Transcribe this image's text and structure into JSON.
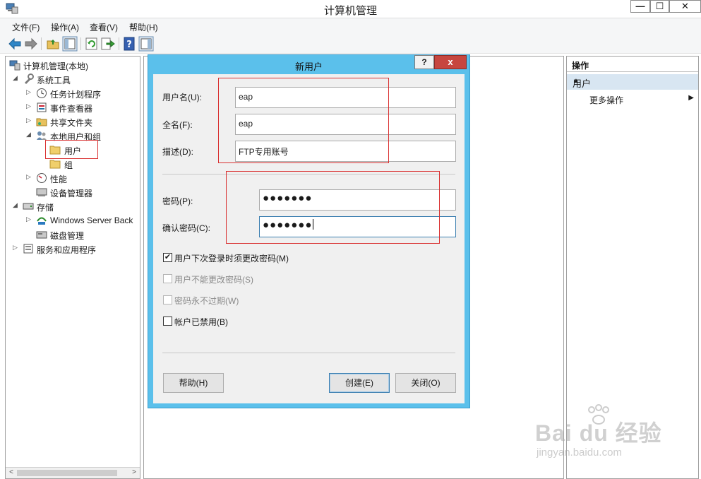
{
  "window": {
    "title": "计算机管理",
    "min_glyph": "—",
    "max_glyph": "☐",
    "close_glyph": "✕"
  },
  "menu": [
    "文件(F)",
    "操作(A)",
    "查看(V)",
    "帮助(H)"
  ],
  "tree": {
    "root": "计算机管理(本地)",
    "system_tools": "系统工具",
    "task_scheduler": "任务计划程序",
    "event_viewer": "事件查看器",
    "shared_folders": "共享文件夹",
    "local_users_groups": "本地用户和组",
    "users": "用户",
    "groups": "组",
    "performance": "性能",
    "device_manager": "设备管理器",
    "storage": "存储",
    "windows_backup": "Windows Server Back",
    "disk_management": "磁盘管理",
    "services_apps": "服务和应用程序"
  },
  "actions": {
    "header": "操作",
    "section": "用户",
    "more": "更多操作"
  },
  "dialog": {
    "title": "新用户",
    "help_glyph": "?",
    "close_glyph": "x",
    "username_label": "用户名(U):",
    "username_value": "eap",
    "fullname_label": "全名(F):",
    "fullname_value": "eap",
    "description_label": "描述(D):",
    "description_value": "FTP专用账号",
    "password_label": "密码(P):",
    "password_value": "●●●●●●●",
    "confirm_label": "确认密码(C):",
    "confirm_value": "●●●●●●●",
    "must_change_label": "用户下次登录时须更改密码(M)",
    "must_change_checked": true,
    "cannot_change_label": "用户不能更改密码(S)",
    "never_expires_label": "密码永不过期(W)",
    "disabled_label": "帐户已禁用(B)",
    "help_button": "帮助(H)",
    "create_button": "创建(E)",
    "close_button": "关闭(O)"
  },
  "watermark": {
    "brand": "Bai du 经验",
    "url": "jingyan.baidu.com"
  }
}
